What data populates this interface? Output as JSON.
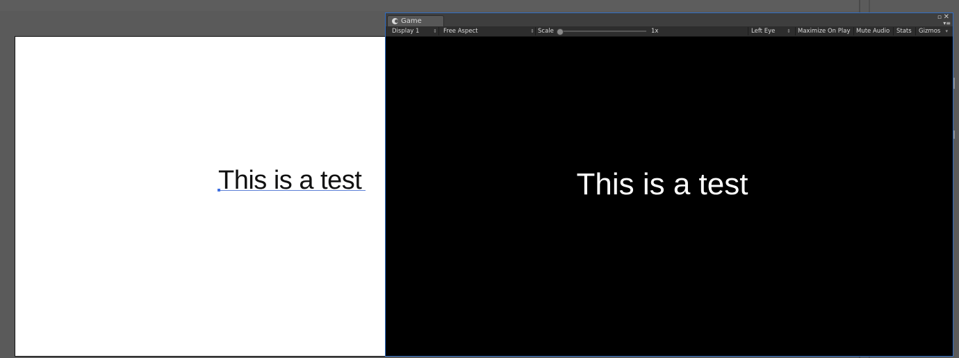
{
  "scene": {
    "text": "This is a test"
  },
  "game_window": {
    "tab_title": "Game",
    "toolbar": {
      "display": "Display 1",
      "aspect": "Free Aspect",
      "scale_label": "Scale",
      "scale_value": "1x",
      "scale_level": 0,
      "eye": "Left Eye",
      "maximize_on_play": "Maximize On Play",
      "mute_audio": "Mute Audio",
      "stats": "Stats",
      "gizmos": "Gizmos"
    },
    "game_text": "This is a test"
  },
  "icons": {
    "tab": "unity-game-icon",
    "maximize": "maximize-icon",
    "close": "close-icon",
    "menu": "menu-icon",
    "dropdown": "dropdown-arrow-icon"
  },
  "colors": {
    "editor_bg": "#5a5a5a",
    "game_border": "#2f6ec7",
    "game_bg": "#000000",
    "canvas_bg": "#ffffff",
    "selection": "#5b7fd6"
  }
}
